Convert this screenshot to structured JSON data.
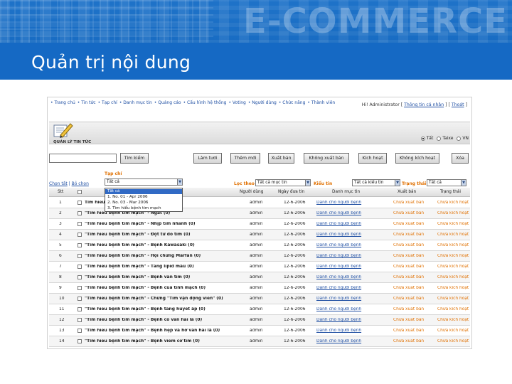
{
  "banner": {
    "title": "Quản trị nội dung",
    "watermark": "E-COMMERCE"
  },
  "nav": {
    "links": [
      "• Trang chủ",
      "• Tin tức",
      "• Tạp chí",
      "• Danh mục tin",
      "• Quảng cáo",
      "• Cấu hình hệ thống",
      "• Voting",
      "• Người dùng",
      "• Chức năng",
      "• Thành viên"
    ],
    "greeting": "Hi! Administrator",
    "info_link": "Thông tin cá nhân",
    "logout_link": "Thoát"
  },
  "module": {
    "title": "QUẢN LÝ TIN TỨC",
    "lang_all": "Tất",
    "lang_taixe": "Taixe",
    "lang_vn": "VN"
  },
  "toolbar": {
    "search_value": "",
    "buttons": [
      "Tìm kiếm",
      "Làm tươi",
      "Thêm mới",
      "Xuất bản",
      "Không xuất bản",
      "Kích hoạt",
      "Không kích hoạt",
      "Xóa"
    ]
  },
  "links": {
    "select_all": "Chọn tất",
    "deselect": "Bỏ chọn"
  },
  "filters": {
    "tapchi_label": "Tạp chí",
    "tapchi_value": "Tất cả",
    "loc_label": "Lọc theo",
    "loc_value": "Tất cả mục tin",
    "kieutin_label": "Kiểu tin",
    "kieutin_value": "Tất cả kiểu tin",
    "trangthai_label": "Trạng thái",
    "trangthai_value": "Tất cả"
  },
  "dropdown": {
    "options": [
      "Tất cả",
      "1. No. 01 - Apr 2006",
      "2. No. 03 - Mar 2006",
      "3. Tìm hiểu bệnh tim mạch"
    ]
  },
  "table": {
    "headers": [
      "Stt",
      "Người dùng",
      "Ngày đưa tin",
      "Danh mục tin",
      "Xuất bản",
      "Trạng thái"
    ],
    "rows": [
      {
        "stt": "1",
        "title": "Tìm hiểu bệnh tim mạch",
        "user": "admin",
        "date": "12-6-2006",
        "cat": "Dành cho người bệnh",
        "pub": "Chưa xuất bản",
        "status": "Chưa kích hoạt"
      },
      {
        "stt": "2",
        "title": "\"Tìm hiểu bệnh tim mạch\" - Ngất (0)",
        "user": "admin",
        "date": "12-6-2006",
        "cat": "Dành cho người bệnh",
        "pub": "Chưa xuất bản",
        "status": "Chưa kích hoạt"
      },
      {
        "stt": "3",
        "title": "\"Tìm hiểu bệnh tim mạch\" - Nhịp tim nhanh (0)",
        "user": "admin",
        "date": "12-6-2006",
        "cat": "Dành cho người bệnh",
        "pub": "Chưa xuất bản",
        "status": "Chưa kích hoạt"
      },
      {
        "stt": "4",
        "title": "\"Tìm hiểu bệnh tim mạch\" - Đột tử do tim (0)",
        "user": "admin",
        "date": "12-6-2006",
        "cat": "Dành cho người bệnh",
        "pub": "Chưa xuất bản",
        "status": "Chưa kích hoạt"
      },
      {
        "stt": "5",
        "title": "\"Tìm hiểu bệnh tim mạch\" - Bệnh Kawasaki (0)",
        "user": "admin",
        "date": "12-6-2006",
        "cat": "Dành cho người bệnh",
        "pub": "Chưa xuất bản",
        "status": "Chưa kích hoạt"
      },
      {
        "stt": "6",
        "title": "\"Tìm hiểu bệnh tim mạch\" - Hội chứng Marfan (0)",
        "user": "admin",
        "date": "12-6-2006",
        "cat": "Dành cho người bệnh",
        "pub": "Chưa xuất bản",
        "status": "Chưa kích hoạt"
      },
      {
        "stt": "7",
        "title": "\"Tìm hiểu bệnh tim mạch\" - Tăng lipid máu (0)",
        "user": "admin",
        "date": "12-6-2006",
        "cat": "Dành cho người bệnh",
        "pub": "Chưa xuất bản",
        "status": "Chưa kích hoạt"
      },
      {
        "stt": "8",
        "title": "\"Tìm hiểu bệnh tim mạch\" - Bệnh van tim (0)",
        "user": "admin",
        "date": "12-6-2006",
        "cat": "Dành cho người bệnh",
        "pub": "Chưa xuất bản",
        "status": "Chưa kích hoạt"
      },
      {
        "stt": "9",
        "title": "\"Tìm hiểu bệnh tim mạch\" - Bệnh của tĩnh mạch (0)",
        "user": "admin",
        "date": "12-6-2006",
        "cat": "Dành cho người bệnh",
        "pub": "Chưa xuất bản",
        "status": "Chưa kích hoạt"
      },
      {
        "stt": "10",
        "title": "\"Tìm hiểu bệnh tim mạch\" - Chứng \"Tim vận động viên\" (0)",
        "user": "admin",
        "date": "12-6-2006",
        "cat": "Dành cho người bệnh",
        "pub": "Chưa xuất bản",
        "status": "Chưa kích hoạt"
      },
      {
        "stt": "11",
        "title": "\"Tìm hiểu bệnh tim mạch\" - Bệnh tăng huyết áp (0)",
        "user": "admin",
        "date": "12-6-2006",
        "cat": "Dành cho người bệnh",
        "pub": "Chưa xuất bản",
        "status": "Chưa kích hoạt"
      },
      {
        "stt": "12",
        "title": "\"Tìm hiểu bệnh tim mạch\" - Bệnh co van hai lá (0)",
        "user": "admin",
        "date": "12-6-2006",
        "cat": "Dành cho người bệnh",
        "pub": "Chưa xuất bản",
        "status": "Chưa kích hoạt"
      },
      {
        "stt": "13",
        "title": "\"Tìm hiểu bệnh tim mạch\" - Bệnh hẹp và hở van hai lá (0)",
        "user": "admin",
        "date": "12-6-2006",
        "cat": "Dành cho người bệnh",
        "pub": "Chưa xuất bản",
        "status": "Chưa kích hoạt"
      },
      {
        "stt": "14",
        "title": "\"Tìm hiểu bệnh tim mạch\" - Bệnh viêm cơ tim (0)",
        "user": "admin",
        "date": "12-6-2006",
        "cat": "Dành cho người bệnh",
        "pub": "Chưa xuất bản",
        "status": "Chưa kích hoạt"
      }
    ]
  },
  "colors": {
    "banner": "#1569c4",
    "link": "#1f4fa3",
    "accent": "#e07000",
    "selection": "#316ac5"
  }
}
